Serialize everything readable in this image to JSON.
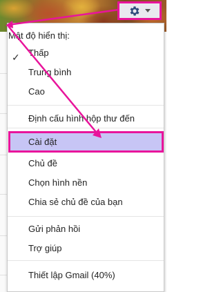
{
  "menu": {
    "density_label": "Mật độ hiển thị:",
    "density_options": [
      {
        "label": "Thấp",
        "checked": true
      },
      {
        "label": "Trung bình",
        "checked": false
      },
      {
        "label": "Cao",
        "checked": false
      }
    ],
    "configure_inbox": "Định cấu hình hộp thư đến",
    "settings": "Cài đặt",
    "themes": "Chủ đề",
    "background": "Chọn hình nền",
    "share_theme": "Chia sẻ chủ đề của bạn",
    "feedback": "Gửi phản hồi",
    "help": "Trợ giúp",
    "gmail_setup": "Thiết lập Gmail (40%)"
  },
  "icons": {
    "gear": "gear-icon",
    "dropdown": "chevron-down-icon",
    "check": "check-icon"
  },
  "colors": {
    "annotation": "#e8149b",
    "highlight": "#c7c5f5",
    "gear_fill": "#2f4b7c"
  }
}
